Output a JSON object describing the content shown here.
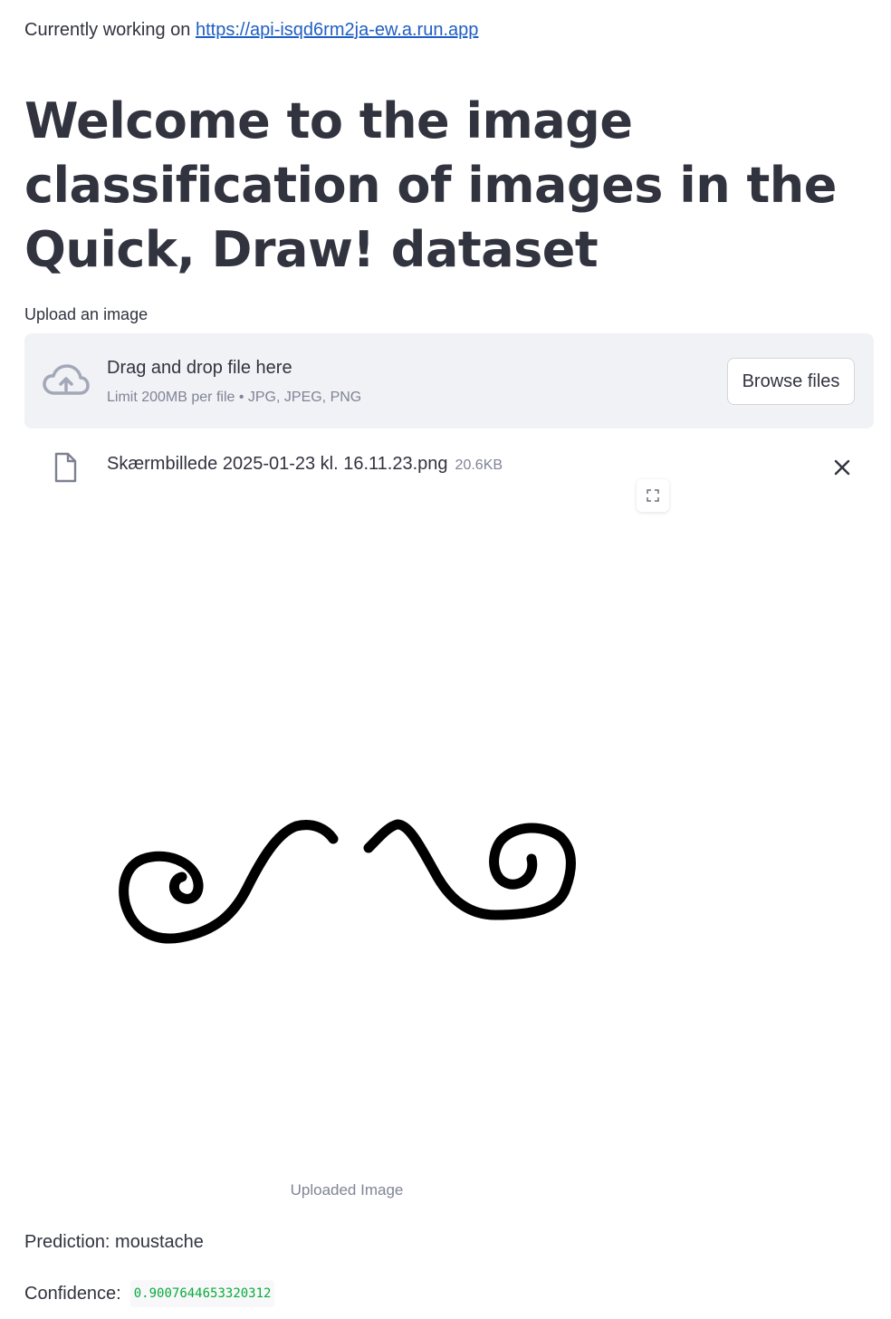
{
  "status": {
    "prefix": "Currently working on",
    "link": "https://api-isqd6rm2ja-ew.a.run.app"
  },
  "title": "Welcome to the image classification of images in the Quick, Draw! dataset",
  "uploader": {
    "label": "Upload an image",
    "drop_title": "Drag and drop file here",
    "limit_text": "Limit 200MB per file • JPG, JPEG, PNG",
    "browse_label": "Browse files"
  },
  "file": {
    "name": "Skærmbillede 2025-01-23 kl. 16.11.23.png",
    "size": "20.6KB"
  },
  "image": {
    "caption": "Uploaded Image"
  },
  "result": {
    "prediction": "Prediction: moustache",
    "confidence_label": "Confidence:",
    "confidence_value": "0.9007644653320312"
  },
  "icons": {
    "upload": "cloud-upload-icon",
    "file": "file-icon",
    "remove": "close-icon",
    "fullscreen": "fullscreen-icon"
  },
  "colors": {
    "text": "#31333f",
    "muted": "#808495",
    "link": "#1f5fc4",
    "dropzone_bg": "#f0f2f6",
    "confidence": "#09ab3b"
  }
}
